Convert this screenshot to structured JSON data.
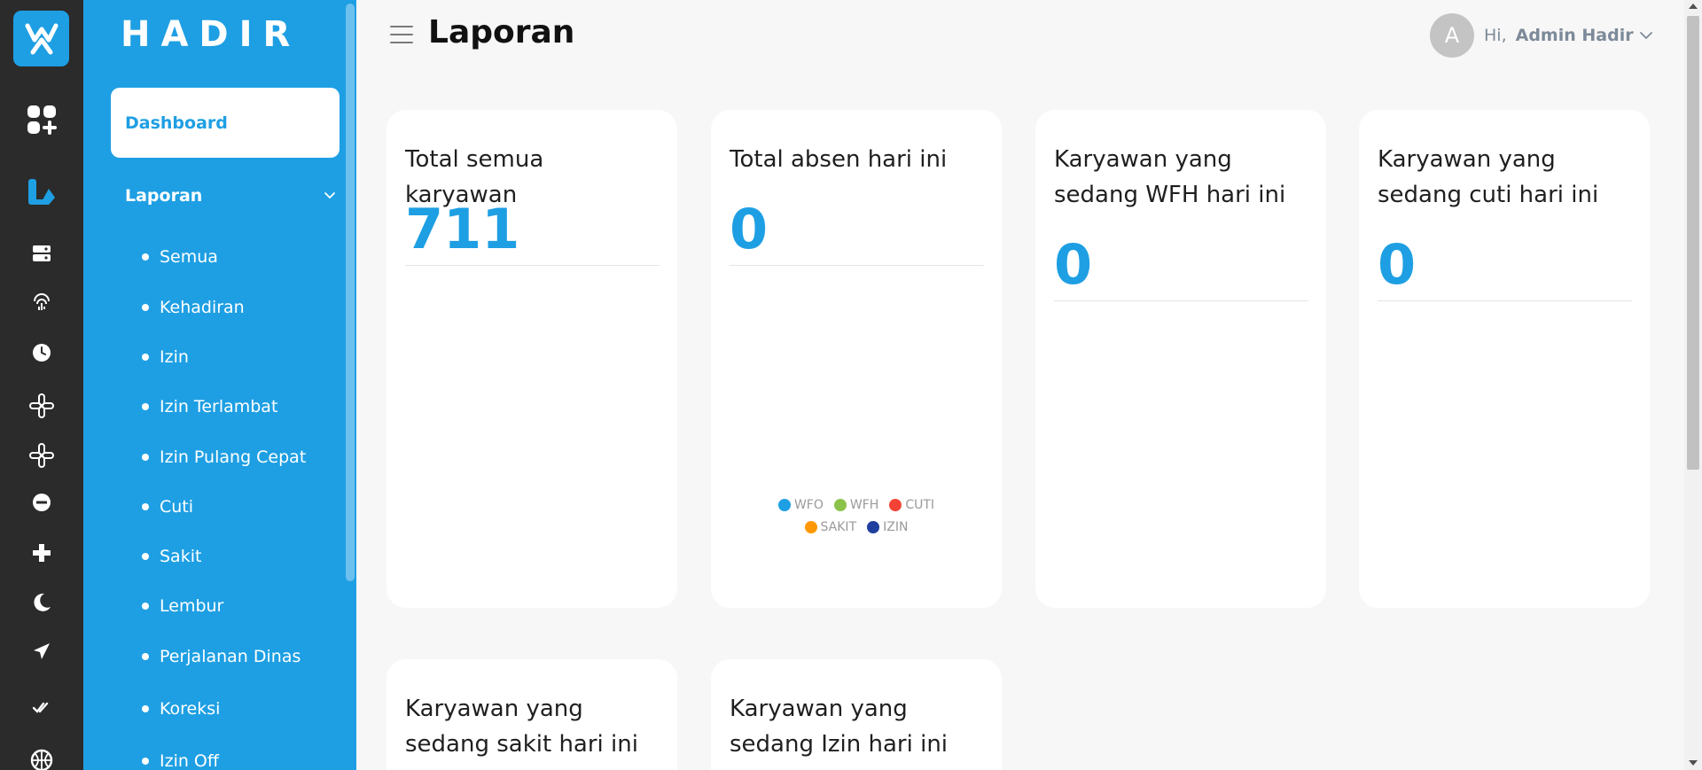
{
  "app": {
    "brand": "HADIR"
  },
  "header": {
    "title": "Laporan",
    "greeting": "Hi,",
    "user_name": "Admin Hadir",
    "avatar_initial": "A"
  },
  "rail": {
    "icons": [
      "hadir-logo-icon",
      "dashboard-icon",
      "report-icon",
      "server-icon",
      "fingerprint-icon",
      "clock-icon",
      "slack-icon",
      "slack-icon",
      "minus-circle-icon",
      "plus-icon",
      "moon-icon",
      "plane-icon",
      "check-double-icon",
      "basketball-icon"
    ]
  },
  "sidebar": {
    "dashboard_label": "Dashboard",
    "laporan_label": "Laporan",
    "sub_items": [
      "Semua",
      "Kehadiran",
      "Izin",
      "Izin Terlambat",
      "Izin Pulang Cepat",
      "Cuti",
      "Sakit",
      "Lembur",
      "Perjalanan Dinas",
      "Koreksi",
      "Izin Off"
    ]
  },
  "cards": [
    {
      "title": "Total semua karyawan",
      "value": "711"
    },
    {
      "title": "Total absen hari ini",
      "value": "0"
    },
    {
      "title": "Karyawan yang sedang WFH hari ini",
      "value": "0"
    },
    {
      "title": "Karyawan yang sedang cuti hari ini",
      "value": "0"
    },
    {
      "title": "Karyawan yang sedang sakit hari ini"
    },
    {
      "title": "Karyawan yang sedang Izin hari ini"
    }
  ],
  "legend": [
    {
      "label": "WFO",
      "color": "#1e9fe3"
    },
    {
      "label": "WFH",
      "color": "#8bc34a"
    },
    {
      "label": "CUTI",
      "color": "#f44336"
    },
    {
      "label": "SAKIT",
      "color": "#ff9800"
    },
    {
      "label": "IZIN",
      "color": "#1e3f9e"
    }
  ],
  "colors": {
    "accent": "#1e9fe3",
    "rail": "#2b2b2b",
    "background": "#f7f7f7"
  }
}
